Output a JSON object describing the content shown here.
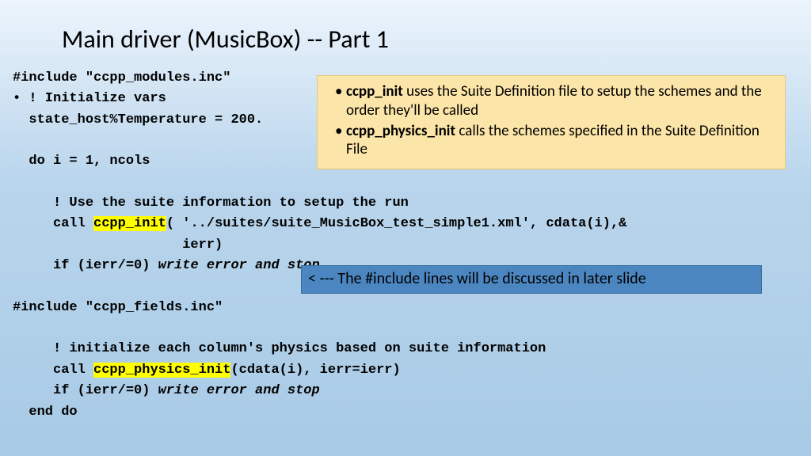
{
  "title": "Main driver (MusicBox)  -- Part 1",
  "code": {
    "l1": "#include \"ccpp_modules.inc\"",
    "l2": "• ! Initialize vars",
    "l3": "  state_host%Temperature = 200.",
    "l4": "",
    "l5": "  do i = 1, ncols",
    "l6": "",
    "l7": "     ! Use the suite information to setup the run",
    "l8a": "     call ",
    "l8b": "ccpp_init",
    "l8c": "( '../suites/suite_MusicBox_test_simple1.xml', cdata(i),&",
    "l9": "                     ierr)",
    "l10a": "     if (ierr/=0) ",
    "l10b": "write error and stop",
    "l11": "",
    "l12": "#include \"ccpp_fields.inc\"",
    "l13": "",
    "l14": "     ! initialize each column's physics based on suite information",
    "l15a": "     call ",
    "l15b": "ccpp_physics_init",
    "l15c": "(cdata(i), ierr=ierr)",
    "l16a": "     if (ierr/=0) ",
    "l16b": "write error and stop",
    "l17": "  end do"
  },
  "callout": {
    "b1_strong": "ccpp_init",
    "b1_rest": " uses the Suite Definition file to setup the schemes and the order they'll be called",
    "b2_strong": "ccpp_physics_init",
    "b2_rest": " calls the schemes specified in the Suite Definition File"
  },
  "bluebox": "< --- The  #include lines will be discussed in later slide"
}
